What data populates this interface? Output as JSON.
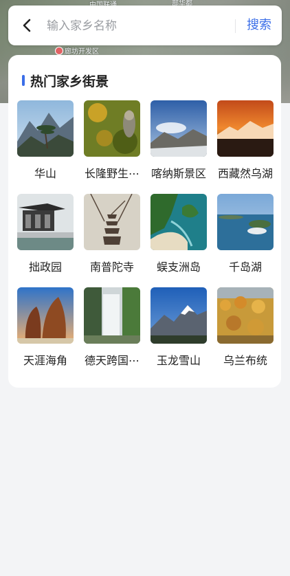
{
  "map": {
    "labels": [
      "中国联通",
      "部华都",
      "廊坊开发区"
    ]
  },
  "search": {
    "placeholder": "输入家乡名称",
    "value": "",
    "button_label": "搜索",
    "back_icon": "chevron-left-icon"
  },
  "section": {
    "title": "热门家乡街景",
    "accent_color": "#3b6ee8"
  },
  "scenes": [
    {
      "label": "华山"
    },
    {
      "label": "长隆野生⋯"
    },
    {
      "label": "喀纳斯景区"
    },
    {
      "label": "西藏然乌湖"
    },
    {
      "label": "拙政园"
    },
    {
      "label": "南普陀寺"
    },
    {
      "label": "蜈支洲岛"
    },
    {
      "label": "千岛湖"
    },
    {
      "label": "天涯海角"
    },
    {
      "label": "德天跨国⋯"
    },
    {
      "label": "玉龙雪山"
    },
    {
      "label": "乌兰布统"
    }
  ]
}
